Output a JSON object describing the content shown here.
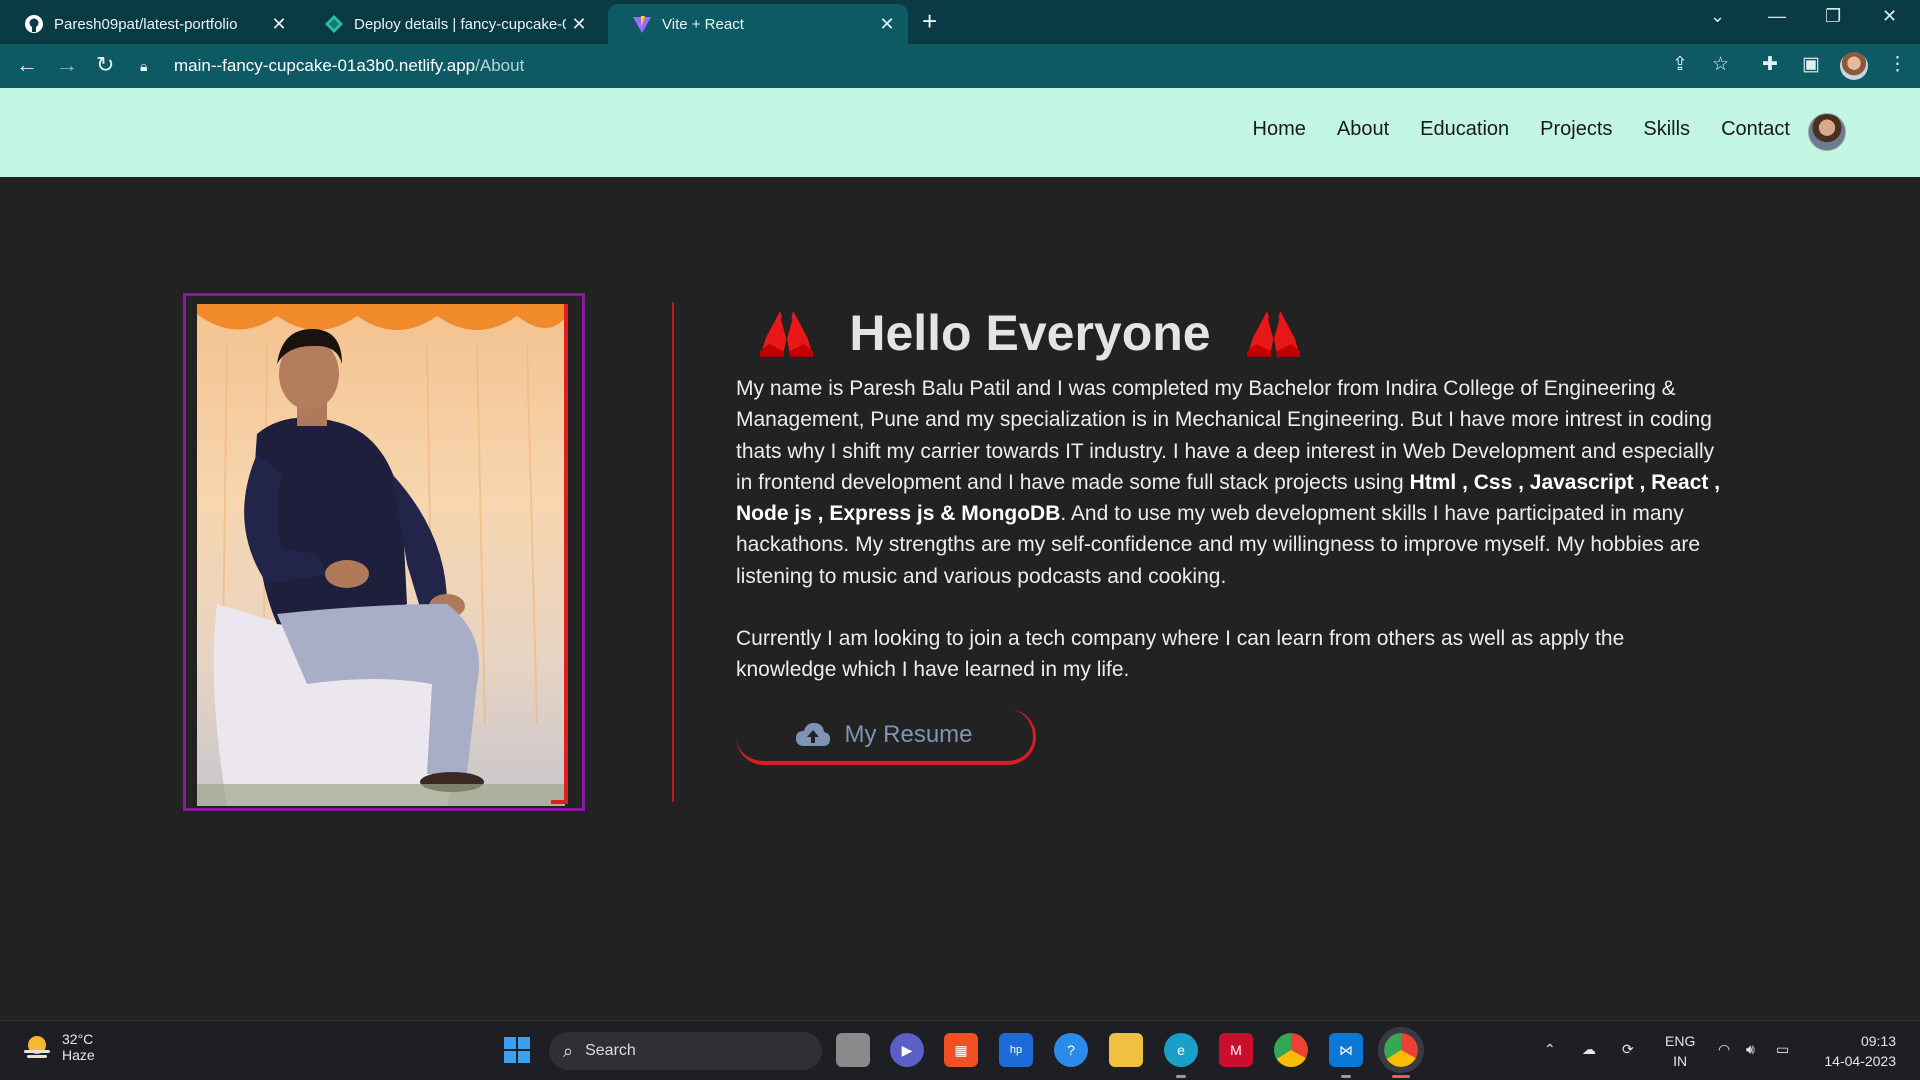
{
  "browser": {
    "tabs": [
      {
        "title": "Paresh09pat/latest-portfolio",
        "icon": "github-icon"
      },
      {
        "title": "Deploy details | fancy-cupcake-0",
        "icon": "netlify-icon"
      },
      {
        "title": "Vite + React",
        "icon": "vite-icon",
        "active": true
      }
    ],
    "url_host": "main--fancy-cupcake-01a3b0.netlify.app",
    "url_path": "/About"
  },
  "site": {
    "nav": [
      "Home",
      "About",
      "Education",
      "Projects",
      "Skills",
      "Contact"
    ]
  },
  "about": {
    "heading": "Hello Everyone",
    "bio_parts": [
      "My name is Paresh Balu Patil and I was completed my Bachelor from Indira College of Engineering & Management, Pune and my specialization is in Mechanical Engineering. But I have more intrest in coding thats why I shift my carrier towards IT industry. I have a deep interest in Web Development and especially in frontend development and I have made some full stack projects using ",
      "Html , Css , Javascript , React , Node js , Express js & MongoDB",
      ". And to use my web development skills I have participated in many hackathons. My strengths are my self-confidence and my willingness to improve myself. My hobbies are listening to music and various podcasts and cooking."
    ],
    "bio_second": "Currently I am looking to join a tech company where I can learn from others as well as apply the knowledge which I have learned in my life.",
    "resume_label": "My Resume"
  },
  "taskbar": {
    "weather_temp": "32°C",
    "weather_desc": "Haze",
    "search_label": "Search",
    "lang_top": "ENG",
    "lang_bottom": "IN",
    "time": "09:13",
    "date": "14-04-2023"
  },
  "colors": {
    "page_bg": "#222222",
    "nav_bg": "#c2f5e2",
    "accent_red": "#d81d24",
    "photo_border": "#8b1aa0",
    "browser_frame": "#0a3a44"
  }
}
